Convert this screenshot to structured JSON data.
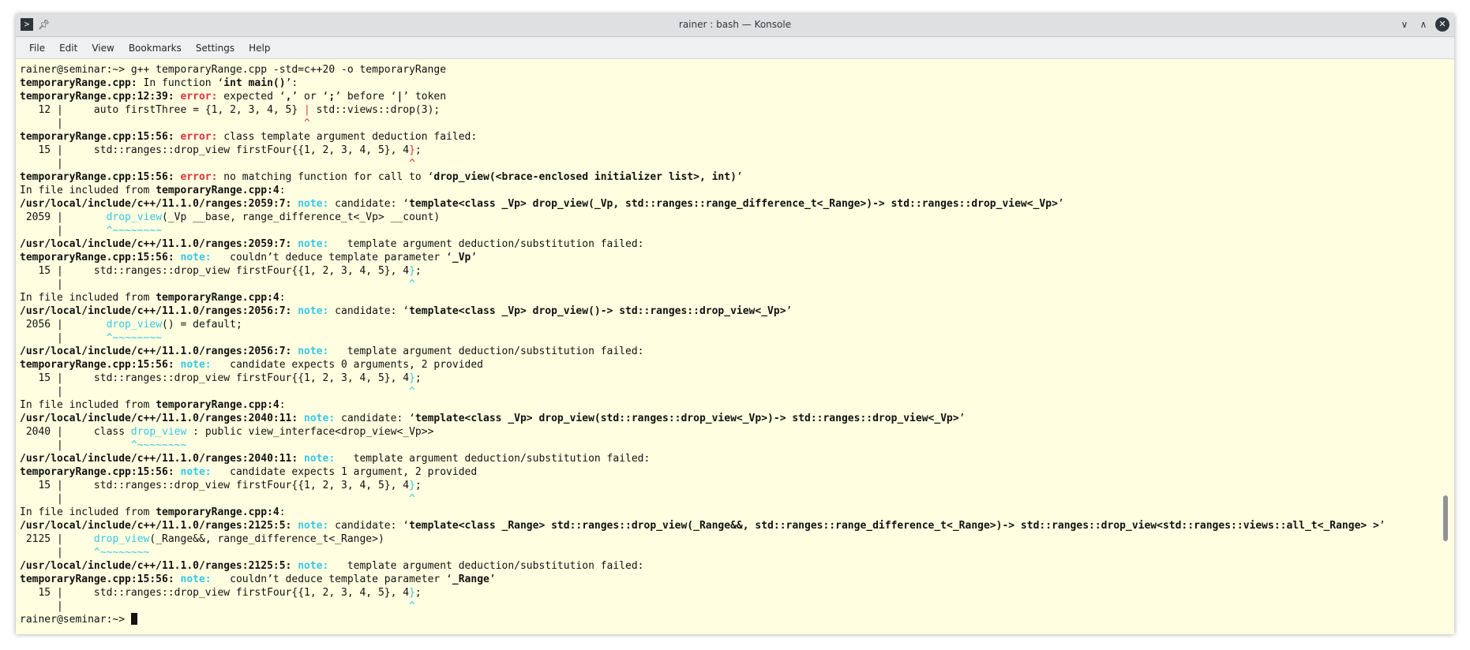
{
  "window": {
    "title": "rainer : bash — Konsole"
  },
  "titlebar_icons": {
    "app": "terminal-icon",
    "pin": "pin-icon",
    "minimize": "chevron-down-icon",
    "maximize": "chevron-up-icon",
    "close": "close-icon"
  },
  "menu": [
    "File",
    "Edit",
    "View",
    "Bookmarks",
    "Settings",
    "Help"
  ],
  "colors": {
    "background": "#fffee0",
    "error": "#e0323b",
    "note": "#36c6e8",
    "text": "#111111"
  },
  "terminal": {
    "lines": [
      [
        {
          "t": "rainer@seminar:~> g++ temporaryRange.cpp -std=c++20 -o temporaryRange"
        }
      ],
      [
        {
          "t": "temporaryRange.cpp:",
          "s": "b"
        },
        {
          "t": " In function ‘"
        },
        {
          "t": "int main()",
          "s": "b"
        },
        {
          "t": "’:"
        }
      ],
      [
        {
          "t": "temporaryRange.cpp:12:39: ",
          "s": "b"
        },
        {
          "t": "error:",
          "s": "err"
        },
        {
          "t": " expected ‘"
        },
        {
          "t": ",",
          "s": "b"
        },
        {
          "t": "’ or ‘"
        },
        {
          "t": ";",
          "s": "b"
        },
        {
          "t": "’ before ‘"
        },
        {
          "t": "|",
          "s": "b"
        },
        {
          "t": "’ token"
        }
      ],
      [
        {
          "t": "   12 |     auto firstThree = {1, 2, 3, 4, 5} "
        },
        {
          "t": "|",
          "s": "rd"
        },
        {
          "t": " std::views::drop(3);"
        }
      ],
      [
        {
          "t": "      |                                       "
        },
        {
          "t": "^",
          "s": "rd"
        }
      ],
      [
        {
          "t": "temporaryRange.cpp:15:56: ",
          "s": "b"
        },
        {
          "t": "error:",
          "s": "err"
        },
        {
          "t": " class template argument deduction failed:"
        }
      ],
      [
        {
          "t": "   15 |     std::ranges::drop_view firstFour{{1, 2, 3, 4, 5}, 4"
        },
        {
          "t": "}",
          "s": "rd"
        },
        {
          "t": ";"
        }
      ],
      [
        {
          "t": "      |                                                        "
        },
        {
          "t": "^",
          "s": "rd"
        }
      ],
      [
        {
          "t": "temporaryRange.cpp:15:56: ",
          "s": "b"
        },
        {
          "t": "error:",
          "s": "err"
        },
        {
          "t": " no matching function for call to ‘"
        },
        {
          "t": "drop_view(<brace-enclosed initializer list>, int)",
          "s": "b"
        },
        {
          "t": "’"
        }
      ],
      [
        {
          "t": "In file included from "
        },
        {
          "t": "temporaryRange.cpp:4",
          "s": "b"
        },
        {
          "t": ":"
        }
      ],
      [
        {
          "t": "/usr/local/include/c++/11.1.0/ranges:2059:7: ",
          "s": "b"
        },
        {
          "t": "note:",
          "s": "note"
        },
        {
          "t": " candidate: ‘"
        },
        {
          "t": "template<class _Vp> drop_view(_Vp, std::ranges::range_difference_t<_Range>)-> std::ranges::drop_view<_Vp>",
          "s": "b"
        },
        {
          "t": "’"
        }
      ],
      [
        {
          "t": " 2059 |       "
        },
        {
          "t": "drop_view",
          "s": "cy"
        },
        {
          "t": "(_Vp __base, range_difference_t<_Vp> __count)"
        }
      ],
      [
        {
          "t": "      |       "
        },
        {
          "t": "^~~~~~~~~",
          "s": "cy"
        }
      ],
      [
        {
          "t": "/usr/local/include/c++/11.1.0/ranges:2059:7: ",
          "s": "b"
        },
        {
          "t": "note:",
          "s": "note"
        },
        {
          "t": "   template argument deduction/substitution failed:"
        }
      ],
      [
        {
          "t": "temporaryRange.cpp:15:56: ",
          "s": "b"
        },
        {
          "t": "note:",
          "s": "note"
        },
        {
          "t": "   couldn’t deduce template parameter ‘"
        },
        {
          "t": "_Vp",
          "s": "b"
        },
        {
          "t": "’"
        }
      ],
      [
        {
          "t": "   15 |     std::ranges::drop_view firstFour{{1, 2, 3, 4, 5}, 4"
        },
        {
          "t": "}",
          "s": "cy"
        },
        {
          "t": ";"
        }
      ],
      [
        {
          "t": "      |                                                        "
        },
        {
          "t": "^",
          "s": "cy"
        }
      ],
      [
        {
          "t": "In file included from "
        },
        {
          "t": "temporaryRange.cpp:4",
          "s": "b"
        },
        {
          "t": ":"
        }
      ],
      [
        {
          "t": "/usr/local/include/c++/11.1.0/ranges:2056:7: ",
          "s": "b"
        },
        {
          "t": "note:",
          "s": "note"
        },
        {
          "t": " candidate: ‘"
        },
        {
          "t": "template<class _Vp> drop_view()-> std::ranges::drop_view<_Vp>",
          "s": "b"
        },
        {
          "t": "’"
        }
      ],
      [
        {
          "t": " 2056 |       "
        },
        {
          "t": "drop_view",
          "s": "cy"
        },
        {
          "t": "() = default;"
        }
      ],
      [
        {
          "t": "      |       "
        },
        {
          "t": "^~~~~~~~~",
          "s": "cy"
        }
      ],
      [
        {
          "t": "/usr/local/include/c++/11.1.0/ranges:2056:7: ",
          "s": "b"
        },
        {
          "t": "note:",
          "s": "note"
        },
        {
          "t": "   template argument deduction/substitution failed:"
        }
      ],
      [
        {
          "t": "temporaryRange.cpp:15:56: ",
          "s": "b"
        },
        {
          "t": "note:",
          "s": "note"
        },
        {
          "t": "   candidate expects 0 arguments, 2 provided"
        }
      ],
      [
        {
          "t": "   15 |     std::ranges::drop_view firstFour{{1, 2, 3, 4, 5}, 4"
        },
        {
          "t": "}",
          "s": "cy"
        },
        {
          "t": ";"
        }
      ],
      [
        {
          "t": "      |                                                        "
        },
        {
          "t": "^",
          "s": "cy"
        }
      ],
      [
        {
          "t": "In file included from "
        },
        {
          "t": "temporaryRange.cpp:4",
          "s": "b"
        },
        {
          "t": ":"
        }
      ],
      [
        {
          "t": "/usr/local/include/c++/11.1.0/ranges:2040:11: ",
          "s": "b"
        },
        {
          "t": "note:",
          "s": "note"
        },
        {
          "t": " candidate: ‘"
        },
        {
          "t": "template<class _Vp> drop_view(std::ranges::drop_view<_Vp>)-> std::ranges::drop_view<_Vp>",
          "s": "b"
        },
        {
          "t": "’"
        }
      ],
      [
        {
          "t": " 2040 |     class "
        },
        {
          "t": "drop_view",
          "s": "cy"
        },
        {
          "t": " : public view_interface<drop_view<_Vp>>"
        }
      ],
      [
        {
          "t": "      |           "
        },
        {
          "t": "^~~~~~~~~",
          "s": "cy"
        }
      ],
      [
        {
          "t": "/usr/local/include/c++/11.1.0/ranges:2040:11: ",
          "s": "b"
        },
        {
          "t": "note:",
          "s": "note"
        },
        {
          "t": "   template argument deduction/substitution failed:"
        }
      ],
      [
        {
          "t": "temporaryRange.cpp:15:56: ",
          "s": "b"
        },
        {
          "t": "note:",
          "s": "note"
        },
        {
          "t": "   candidate expects 1 argument, 2 provided"
        }
      ],
      [
        {
          "t": "   15 |     std::ranges::drop_view firstFour{{1, 2, 3, 4, 5}, 4"
        },
        {
          "t": "}",
          "s": "cy"
        },
        {
          "t": ";"
        }
      ],
      [
        {
          "t": "      |                                                        "
        },
        {
          "t": "^",
          "s": "cy"
        }
      ],
      [
        {
          "t": "In file included from "
        },
        {
          "t": "temporaryRange.cpp:4",
          "s": "b"
        },
        {
          "t": ":"
        }
      ],
      [
        {
          "t": "/usr/local/include/c++/11.1.0/ranges:2125:5: ",
          "s": "b"
        },
        {
          "t": "note:",
          "s": "note"
        },
        {
          "t": " candidate: ‘"
        },
        {
          "t": "template<class _Range> std::ranges::drop_view(_Range&&, std::ranges::range_difference_t<_Range>)-> std::ranges::drop_view<std::ranges::views::all_t<_Range> >",
          "s": "b"
        },
        {
          "t": "’"
        }
      ],
      [
        {
          "t": " 2125 |     "
        },
        {
          "t": "drop_view",
          "s": "cy"
        },
        {
          "t": "(_Range&&, range_difference_t<_Range>)"
        }
      ],
      [
        {
          "t": "      |     "
        },
        {
          "t": "^~~~~~~~~",
          "s": "cy"
        }
      ],
      [
        {
          "t": "/usr/local/include/c++/11.1.0/ranges:2125:5: ",
          "s": "b"
        },
        {
          "t": "note:",
          "s": "note"
        },
        {
          "t": "   template argument deduction/substitution failed:"
        }
      ],
      [
        {
          "t": "temporaryRange.cpp:15:56: ",
          "s": "b"
        },
        {
          "t": "note:",
          "s": "note"
        },
        {
          "t": "   couldn’t deduce template parameter ‘"
        },
        {
          "t": "_Range",
          "s": "b"
        },
        {
          "t": "’"
        }
      ],
      [
        {
          "t": "   15 |     std::ranges::drop_view firstFour{{1, 2, 3, 4, 5}, 4"
        },
        {
          "t": "}",
          "s": "cy"
        },
        {
          "t": ";"
        }
      ],
      [
        {
          "t": "      |                                                        "
        },
        {
          "t": "^",
          "s": "cy"
        }
      ]
    ],
    "prompt": "rainer@seminar:~> "
  }
}
